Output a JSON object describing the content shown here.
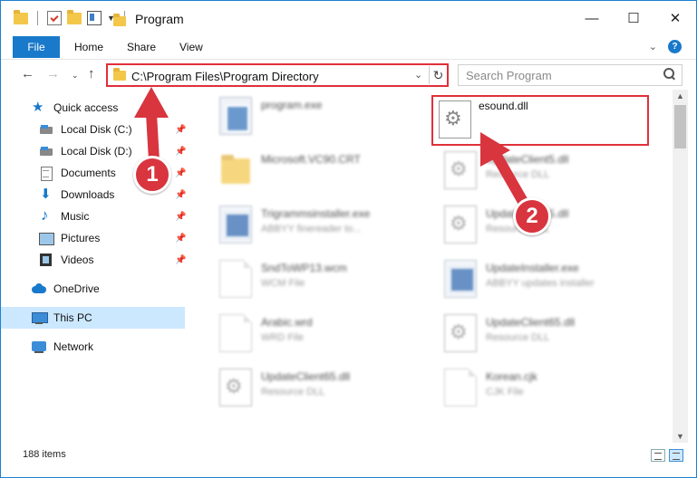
{
  "window": {
    "title": "Program",
    "controls": {
      "minimize": "—",
      "maximize": "☐",
      "close": "✕"
    }
  },
  "ribbon": {
    "tabs": [
      "File",
      "Home",
      "Share",
      "View"
    ],
    "help": "?"
  },
  "nav": {
    "address": "C:\\Program Files\\Program Directory",
    "search_placeholder": "Search Program"
  },
  "sidebar": {
    "items": [
      {
        "label": "Quick access",
        "icon": "star-icon"
      },
      {
        "label": "Local Disk (C:)",
        "icon": "disk-icon",
        "pinned": true
      },
      {
        "label": "Local Disk (D:)",
        "icon": "disk-icon",
        "pinned": true
      },
      {
        "label": "Documents",
        "icon": "documents-icon",
        "pinned": true
      },
      {
        "label": "Downloads",
        "icon": "downloads-icon",
        "pinned": true
      },
      {
        "label": "Music",
        "icon": "music-icon",
        "pinned": true
      },
      {
        "label": "Pictures",
        "icon": "pictures-icon",
        "pinned": true
      },
      {
        "label": "Videos",
        "icon": "videos-icon",
        "pinned": true
      },
      {
        "label": "OneDrive",
        "icon": "onedrive-icon"
      },
      {
        "label": "This PC",
        "icon": "this-pc-icon",
        "selected": true
      },
      {
        "label": "Network",
        "icon": "network-icon"
      }
    ]
  },
  "files": [
    {
      "name": "program.exe",
      "type": "",
      "icon": "exe-icon"
    },
    {
      "name": "esound.dll",
      "type": "",
      "icon": "dll-gear-icon",
      "highlighted": true
    },
    {
      "name": "Microsoft.VC90.CRT",
      "type": "",
      "icon": "folder-icon"
    },
    {
      "name": "UpdateClient5.dll",
      "type": "Resource DLL",
      "icon": "dll-gear-icon"
    },
    {
      "name": "Trigrammsinstaller.exe",
      "type": "ABBYY finereader to...",
      "icon": "installer-icon"
    },
    {
      "name": "UpdateClient5.dll",
      "type": "Resource DLL",
      "icon": "dll-gear-icon"
    },
    {
      "name": "SndToWP13.wcm",
      "type": "WCM File",
      "icon": "file-icon"
    },
    {
      "name": "UpdateInstaller.exe",
      "type": "ABBYY updates installer",
      "icon": "installer-icon"
    },
    {
      "name": "Arabic.wrd",
      "type": "WRD File",
      "icon": "file-icon"
    },
    {
      "name": "UpdateClient65.dll",
      "type": "Resource DLL",
      "icon": "dll-gear-icon"
    },
    {
      "name": "UpdateClient65.dll",
      "type": "Resource DLL",
      "icon": "dll-gear-icon"
    },
    {
      "name": "Korean.cjk",
      "type": "CJK File",
      "icon": "file-icon"
    }
  ],
  "status": {
    "item_count": "188 items"
  },
  "annotations": {
    "badge1": "1",
    "badge2": "2",
    "arrow_color": "#d8353f"
  }
}
